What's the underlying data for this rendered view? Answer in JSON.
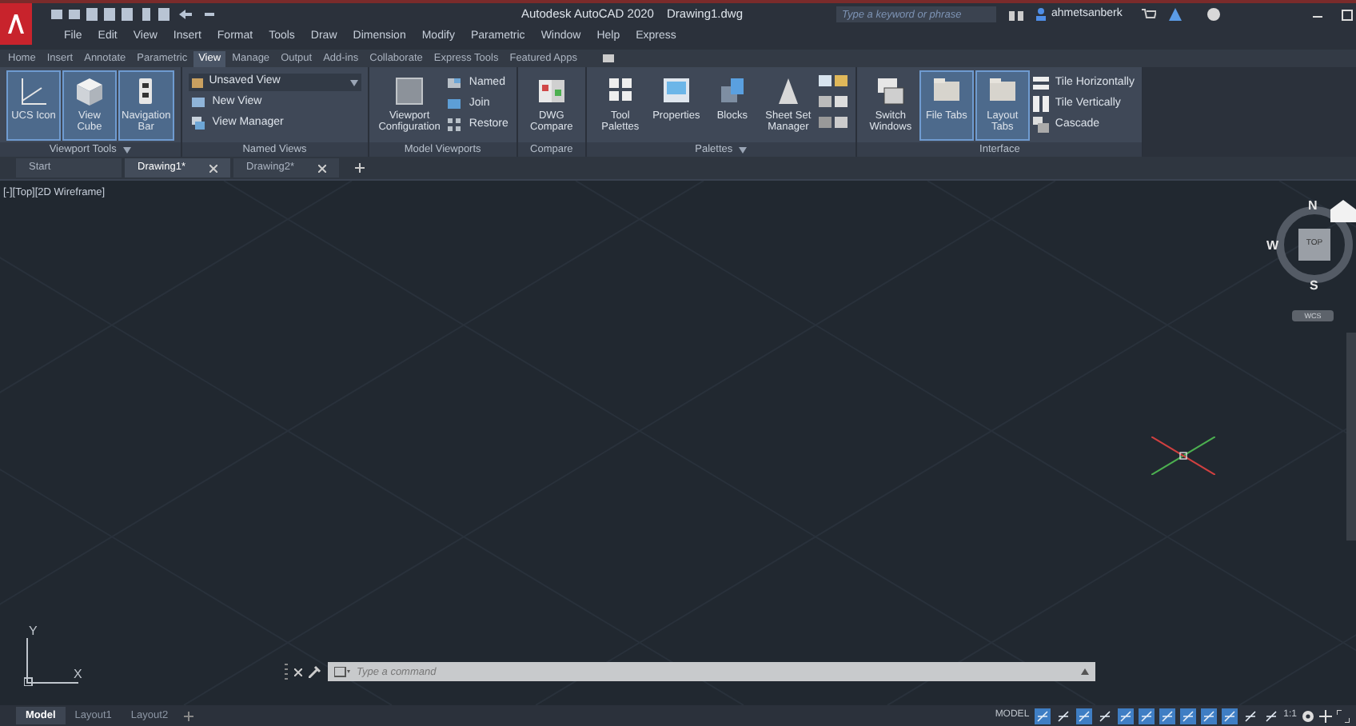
{
  "title_bar": {
    "app": "Autodesk AutoCAD 2020",
    "file": "Drawing1.dwg",
    "search": {
      "placeholder": "Type a keyword or phrase"
    },
    "user": "ahmetsanberk"
  },
  "menu": [
    "File",
    "Edit",
    "View",
    "Insert",
    "Format",
    "Tools",
    "Draw",
    "Dimension",
    "Modify",
    "Parametric",
    "Window",
    "Help",
    "Express"
  ],
  "ribbon_tabs": [
    {
      "label": "Home",
      "selected": false
    },
    {
      "label": "Insert",
      "selected": false
    },
    {
      "label": "Annotate",
      "selected": false
    },
    {
      "label": "Parametric",
      "selected": false
    },
    {
      "label": "View",
      "selected": true
    },
    {
      "label": "Manage",
      "selected": false
    },
    {
      "label": "Output",
      "selected": false
    },
    {
      "label": "Add-ins",
      "selected": false
    },
    {
      "label": "Collaborate",
      "selected": false
    },
    {
      "label": "Express Tools",
      "selected": false
    },
    {
      "label": "Featured Apps",
      "selected": false
    }
  ],
  "panels": [
    {
      "title": "Viewport Tools",
      "menu": true,
      "items": [
        {
          "kind": "large",
          "label": "UCS Icon",
          "selected": true
        },
        {
          "kind": "large",
          "label": "View Cube",
          "selected": true
        },
        {
          "kind": "large",
          "label": "Navigation Bar",
          "selected": true
        }
      ]
    },
    {
      "title": "Named Views",
      "menu": false,
      "items": [
        {
          "kind": "dropdown",
          "label": "Unsaved View"
        },
        {
          "kind": "small",
          "label": "New View"
        },
        {
          "kind": "small",
          "label": "View Manager"
        }
      ]
    },
    {
      "title": "Model Viewports",
      "menu": false,
      "items": [
        {
          "kind": "large",
          "label": "Viewport Configuration",
          "selected": false
        },
        {
          "kind": "small",
          "label": "Named"
        },
        {
          "kind": "small",
          "label": "Join"
        },
        {
          "kind": "small",
          "label": "Restore"
        }
      ]
    },
    {
      "title": "Compare",
      "menu": false,
      "items": [
        {
          "kind": "large",
          "label": "DWG Compare",
          "selected": false
        }
      ]
    },
    {
      "title": "Palettes",
      "menu": true,
      "items": [
        {
          "kind": "large",
          "label": "Tool Palettes",
          "selected": false
        },
        {
          "kind": "large",
          "label": "Properties",
          "selected": false
        },
        {
          "kind": "large",
          "label": "Blocks",
          "selected": false
        },
        {
          "kind": "large",
          "label": "Sheet Set Manager",
          "selected": false
        },
        {
          "kind": "grid"
        }
      ]
    },
    {
      "title": "Interface",
      "menu": false,
      "items": [
        {
          "kind": "large",
          "label": "Switch Windows",
          "selected": false
        },
        {
          "kind": "large",
          "label": "File Tabs",
          "selected": true
        },
        {
          "kind": "large",
          "label": "Layout Tabs",
          "selected": true
        },
        {
          "kind": "small",
          "label": "Tile Horizontally"
        },
        {
          "kind": "small",
          "label": "Tile Vertically"
        },
        {
          "kind": "small",
          "label": "Cascade"
        }
      ]
    }
  ],
  "file_tabs": [
    {
      "label": "Start",
      "selected": false,
      "closable": false
    },
    {
      "label": "Drawing1*",
      "selected": true,
      "closable": true
    },
    {
      "label": "Drawing2*",
      "selected": false,
      "closable": true
    }
  ],
  "viewport": {
    "label": "[-][Top][2D Wireframe]",
    "viewcube": {
      "north": "N",
      "west": "W",
      "south": "S",
      "face": "TOP",
      "ucs": "WCS"
    },
    "ucs_axes": {
      "y": "Y",
      "x": "X"
    }
  },
  "command_line": {
    "placeholder": "Type a command"
  },
  "layout_tabs": [
    {
      "label": "Model",
      "selected": true
    },
    {
      "label": "Layout1",
      "selected": false
    },
    {
      "label": "Layout2",
      "selected": false
    }
  ],
  "status_bar": {
    "mode": "MODEL",
    "scale": "1:1",
    "toggles": [
      {
        "on": true
      },
      {
        "on": false
      },
      {
        "on": true
      },
      {
        "on": false
      },
      {
        "on": true
      },
      {
        "on": true
      },
      {
        "on": true
      },
      {
        "on": true
      },
      {
        "on": true
      },
      {
        "on": true
      },
      {
        "on": false
      },
      {
        "on": false
      }
    ]
  }
}
